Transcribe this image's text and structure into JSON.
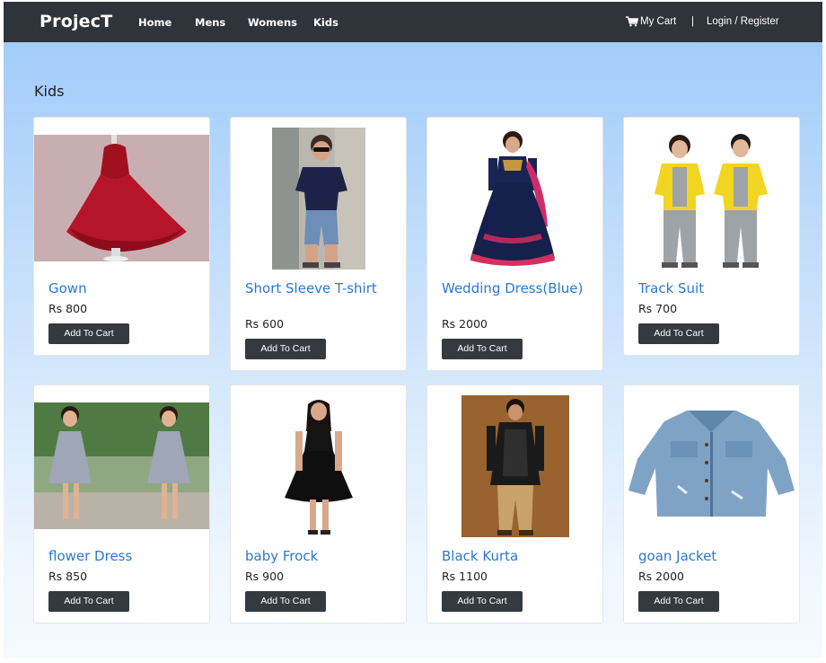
{
  "nav": {
    "brand": "ProjecT",
    "links": [
      "Home",
      "Mens",
      "Womens",
      "Kids"
    ],
    "cart_label": "My Cart",
    "separator": "|",
    "login_label": "Login / Register"
  },
  "section": {
    "title": "Kids"
  },
  "button_label": "Add To Cart",
  "products": [
    {
      "name": "Gown",
      "price": "Rs 800",
      "image": "red-gown-image"
    },
    {
      "name": "Short Sleeve T-shirt",
      "price": "Rs 600",
      "image": "boy-tshirt-image"
    },
    {
      "name": "Wedding Dress(Blue)",
      "price": "Rs 2000",
      "image": "girl-blue-lehenga-image"
    },
    {
      "name": "Track Suit",
      "price": "Rs 700",
      "image": "kids-track-suit-image"
    },
    {
      "name": "flower Dress",
      "price": "Rs 850",
      "image": "girls-floral-dress-image"
    },
    {
      "name": "baby Frock",
      "price": "Rs 900",
      "image": "girl-black-frock-image"
    },
    {
      "name": "Black Kurta",
      "price": "Rs 1100",
      "image": "boy-black-kurta-image"
    },
    {
      "name": "goan Jacket",
      "price": "Rs 2000",
      "image": "denim-jacket-image"
    }
  ],
  "colors": {
    "navbar": "#2f343a",
    "link": "#2b78d4",
    "button": "#343a40",
    "background_top": "#9cc9f9",
    "background_bottom": "#f6faff"
  }
}
